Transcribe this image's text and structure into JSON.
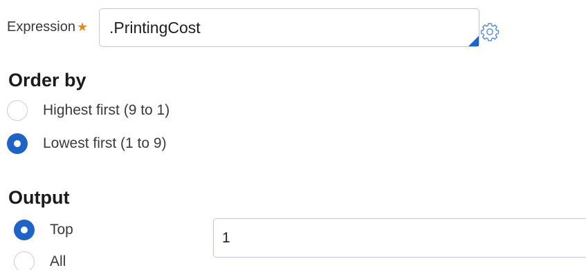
{
  "expression": {
    "label": "Expression",
    "required_mark": "★",
    "value": ".PrintingCost"
  },
  "order_by": {
    "title": "Order by",
    "options": [
      {
        "label": "Highest first (9 to 1)",
        "selected": false
      },
      {
        "label": "Lowest first (1 to 9)",
        "selected": true
      }
    ]
  },
  "output": {
    "title": "Output",
    "options": [
      {
        "label": "Top",
        "selected": true
      },
      {
        "label": "All",
        "selected": false
      }
    ],
    "top_value": "1"
  },
  "colors": {
    "accent": "#1f63c5",
    "required": "#e08a1e"
  },
  "icons": {
    "gear": "gear-icon"
  }
}
